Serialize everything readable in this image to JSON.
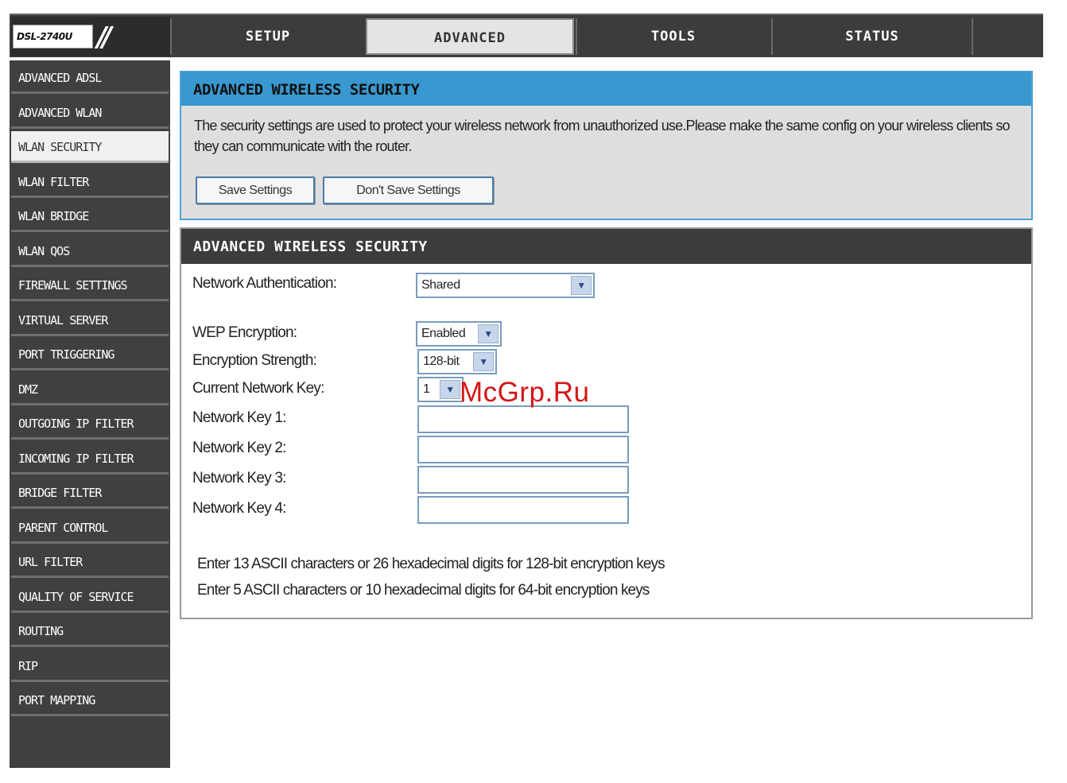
{
  "header": {
    "model": "DSL-2740U",
    "logo_slash": "//",
    "tabs": [
      {
        "label": "SETUP"
      },
      {
        "label": "ADVANCED"
      },
      {
        "label": "TOOLS"
      },
      {
        "label": "STATUS"
      }
    ],
    "active_tab": "ADVANCED"
  },
  "sidebar": {
    "items": [
      {
        "label": "ADVANCED ADSL"
      },
      {
        "label": "ADVANCED WLAN"
      },
      {
        "label": "WLAN SECURITY"
      },
      {
        "label": "WLAN FILTER"
      },
      {
        "label": "WLAN BRIDGE"
      },
      {
        "label": "WLAN QOS"
      },
      {
        "label": "FIREWALL SETTINGS"
      },
      {
        "label": "VIRTUAL SERVER"
      },
      {
        "label": "PORT TRIGGERING"
      },
      {
        "label": "DMZ"
      },
      {
        "label": "OUTGOING IP FILTER"
      },
      {
        "label": "INCOMING IP FILTER"
      },
      {
        "label": "BRIDGE FILTER"
      },
      {
        "label": "PARENT CONTROL"
      },
      {
        "label": "URL FILTER"
      },
      {
        "label": "QUALITY OF SERVICE"
      },
      {
        "label": "ROUTING"
      },
      {
        "label": "RIP"
      },
      {
        "label": "PORT MAPPING"
      }
    ],
    "active_item": "WLAN SECURITY"
  },
  "info_panel": {
    "title": "ADVANCED WIRELESS SECURITY",
    "description": "The security settings are used to protect your wireless network from unauthorized use.Please make the same config on your wireless clients so they can communicate with the router.",
    "save_label": "Save Settings",
    "dont_save_label": "Don't Save Settings"
  },
  "security_panel": {
    "title": "ADVANCED WIRELESS SECURITY",
    "network_auth": {
      "label": "Network Authentication:",
      "value": "Shared"
    },
    "wep_encryption": {
      "label": "WEP Encryption:",
      "value": "Enabled"
    },
    "encryption_strength": {
      "label": "Encryption Strength:",
      "value": "128-bit"
    },
    "current_key": {
      "label": "Current Network Key:",
      "value": "1"
    },
    "keys": [
      {
        "label": "Network Key 1:",
        "value": ""
      },
      {
        "label": "Network Key 2:",
        "value": ""
      },
      {
        "label": "Network Key 3:",
        "value": ""
      },
      {
        "label": "Network Key 4:",
        "value": ""
      }
    ],
    "notes": [
      "Enter 13 ASCII characters or 26 hexadecimal digits for 128-bit encryption keys",
      "Enter 5 ASCII characters or 10 hexadecimal digits for 64-bit encryption keys"
    ]
  },
  "watermark": "McGrp.Ru",
  "icons": {
    "dropdown": "chevron-down-icon"
  },
  "colors": {
    "accent": "#3898cf",
    "dark": "#3c3c3c",
    "watermark": "#d41616"
  }
}
